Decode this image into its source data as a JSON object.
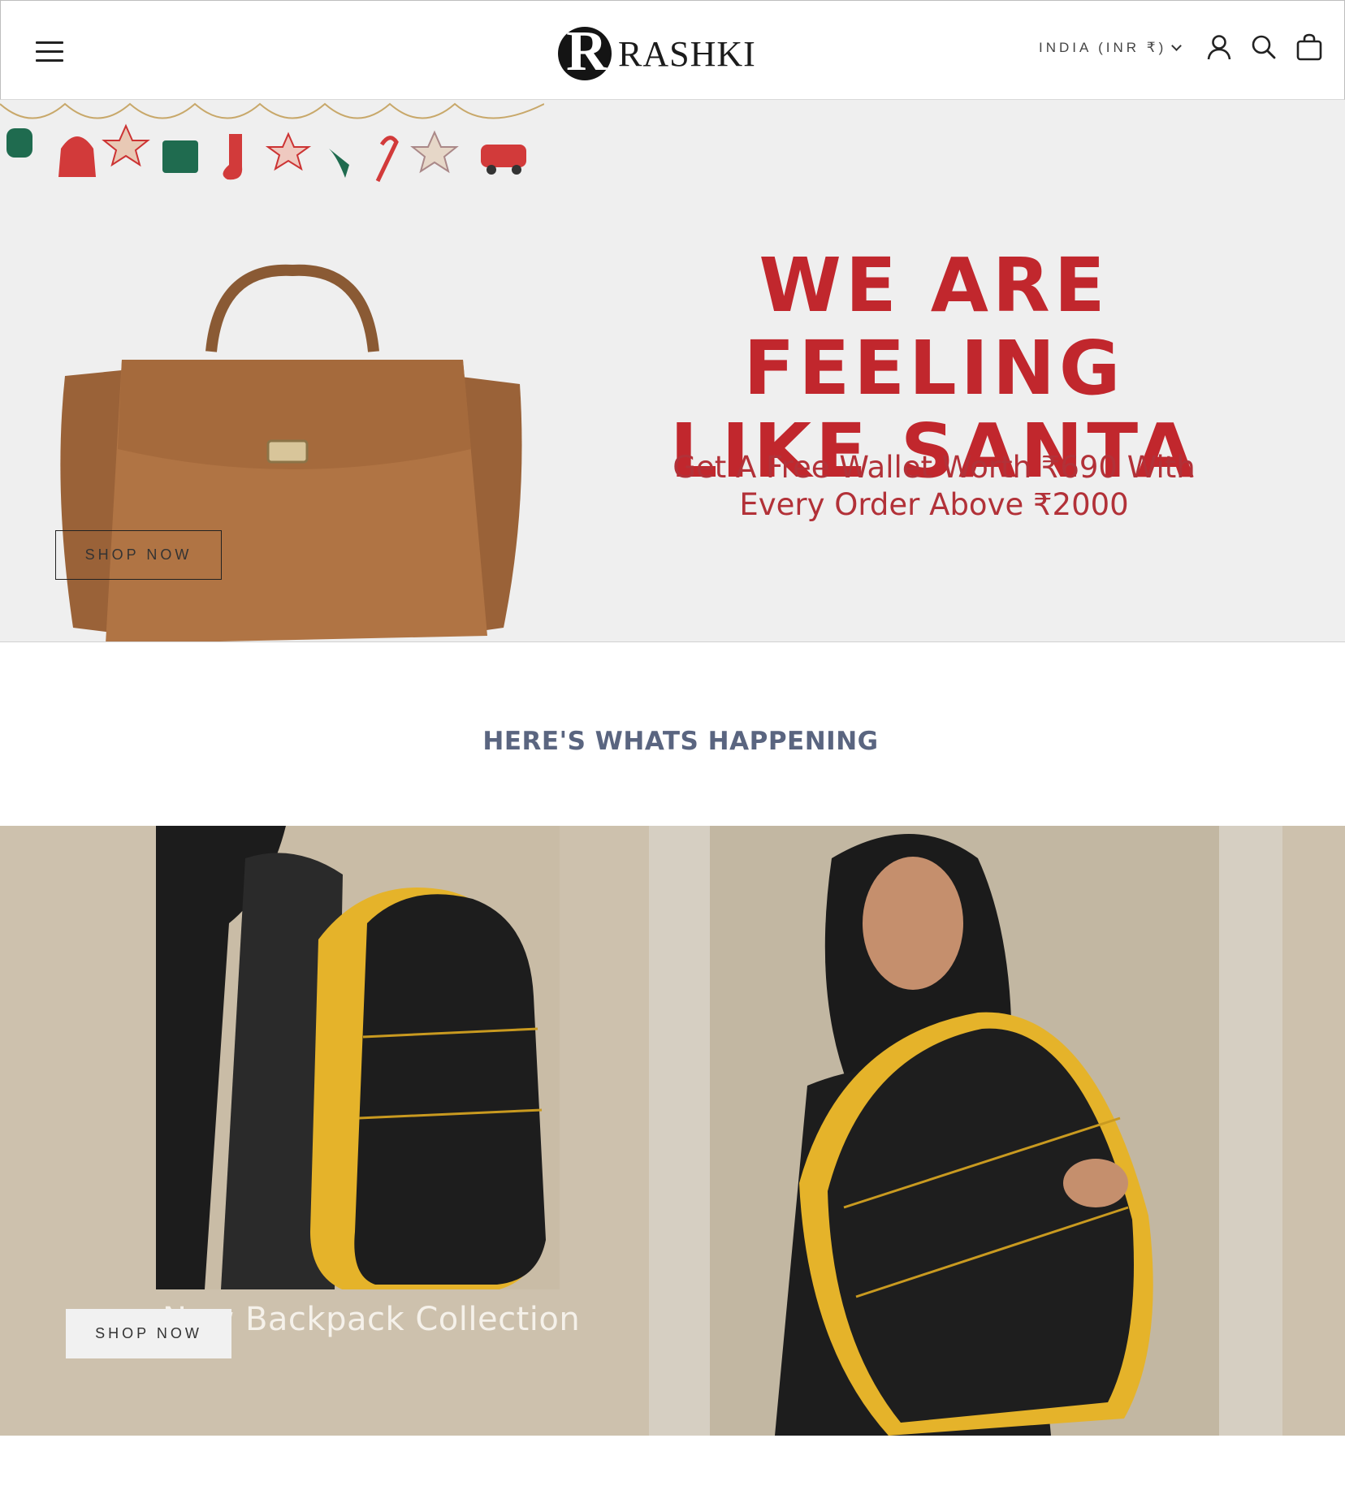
{
  "header": {
    "brand": "RASHKI",
    "brand_mark": "R",
    "country_selector": "INDIA (INR ₹)",
    "icons": [
      "menu-icon",
      "account-icon",
      "search-icon",
      "cart-icon"
    ]
  },
  "hero": {
    "title_line1": "WE ARE FEELING",
    "title_line2": "LIKE SANTA",
    "subtitle_line1": "Get A Free Wallet Worth ₹690 With",
    "subtitle_line2": "Every Order Above ₹2000",
    "cta": "SHOP NOW",
    "accent_color": "#c1272d"
  },
  "happening": {
    "heading": "HERE'S WHATS HAPPENING",
    "caption": "New Backpack Collection",
    "cta": "SHOP NOW"
  }
}
